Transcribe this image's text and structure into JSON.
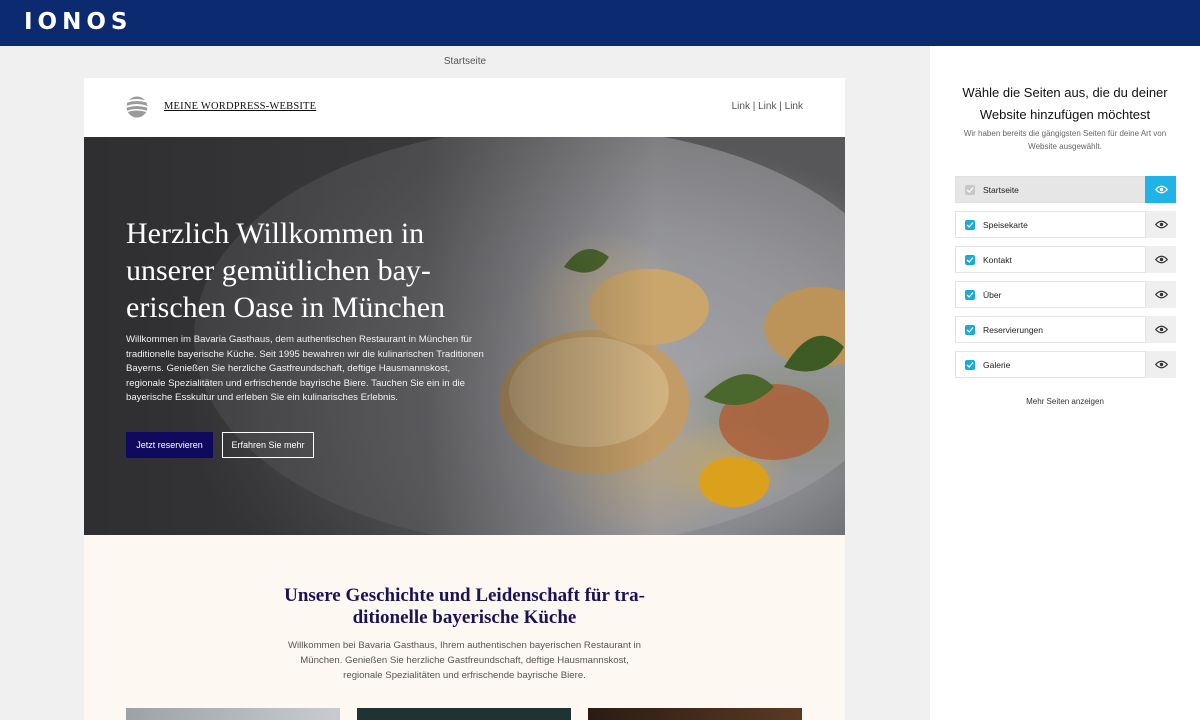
{
  "app": {
    "logo": "IONOS"
  },
  "preview": {
    "label": "Startseite",
    "site": {
      "title": "MEINE WORDPRESS-WEBSITE",
      "nav": [
        "Link",
        "Link",
        "Link"
      ],
      "nav_separator": " | ",
      "hero": {
        "heading": "Herzlich Willkommen in unserer gemütlichen bay­erischen Oase in München",
        "text": "Willkommen im Bavaria Gasthaus, dem authentischen Restaurant in München für traditionelle bayerische Küche. Seit 1995 bewahren wir die kulinarischen Traditionen Bayerns. Genießen Sie herzliche Gastfreundschaft, deftige Hausmannskost, regionale Spezialitäten und erfrischende bayrische Biere. Tauchen Sie ein in die bayerische Esskultur und erleben Sie ein kulinarisches Erlebnis.",
        "primary_button": "Jetzt reservieren",
        "secondary_button": "Erfahren Sie mehr"
      },
      "story": {
        "heading": "Unsere Geschichte und Leidenschaft für tra­ditionelle bayerische Küche",
        "text": "Willkommen bei Bavaria Gasthaus, Ihrem authentischen bayerischen Restaurant in München. Genießen Sie herzliche Gastfreundschaft, deftige Hausmannskost, regionale Spezialitäten und erfrischende bayrische Biere."
      }
    }
  },
  "panel": {
    "title": "Wähle die Seiten aus, die du deiner Website hinzufügen möchtest",
    "subtitle": "Wir haben bereits die gängigsten Seiten für deine Art von Website ausgewählt.",
    "pages": [
      {
        "label": "Startseite",
        "checked": true,
        "locked": true,
        "active": true
      },
      {
        "label": "Speisekarte",
        "checked": true,
        "locked": false,
        "active": false
      },
      {
        "label": "Kontakt",
        "checked": true,
        "locked": false,
        "active": false
      },
      {
        "label": "Über",
        "checked": true,
        "locked": false,
        "active": false
      },
      {
        "label": "Reservierungen",
        "checked": true,
        "locked": false,
        "active": false
      },
      {
        "label": "Galerie",
        "checked": true,
        "locked": false,
        "active": false
      }
    ],
    "more_link": "Mehr Seiten anzeigen"
  },
  "colors": {
    "topbar": "#0b2a6f",
    "accent": "#1fb3e8",
    "checkbox": "#1aa9d8",
    "primary_button": "#0f0a5e",
    "heading_dark": "#1a1456"
  },
  "icons": {
    "site_logo": "globe-stripes-icon",
    "eye": "eye-icon",
    "checkbox": "check-icon"
  }
}
